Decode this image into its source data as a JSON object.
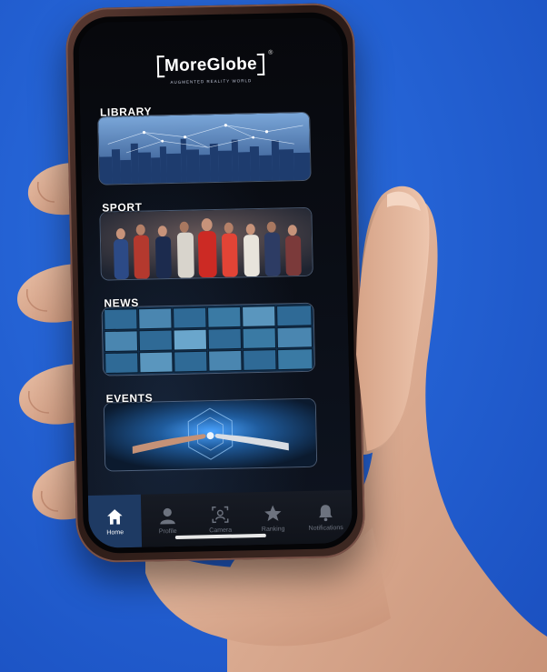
{
  "app": {
    "logo_text": "MoreGlobe",
    "logo_mark": "®",
    "tagline": "AUGMENTED REALITY WORLD"
  },
  "sections": [
    {
      "label": "LIBRARY",
      "image": "city-skyline-network"
    },
    {
      "label": "SPORT",
      "image": "athletes-group"
    },
    {
      "label": "NEWS",
      "image": "video-wall-screens"
    },
    {
      "label": "EVENTS",
      "image": "robot-human-hands-touch"
    }
  ],
  "tabbar": {
    "items": [
      {
        "label": "Home",
        "icon": "house-icon",
        "active": true
      },
      {
        "label": "Profile",
        "icon": "person-icon",
        "active": false
      },
      {
        "label": "Camera",
        "icon": "ar-camera-icon",
        "active": false
      },
      {
        "label": "Ranking",
        "icon": "star-icon",
        "active": false
      },
      {
        "label": "Notifications",
        "icon": "bell-icon",
        "active": false
      }
    ]
  },
  "colors": {
    "background": "#2462d4",
    "tab_active": "#1e3a63",
    "screen": "#07080c"
  }
}
